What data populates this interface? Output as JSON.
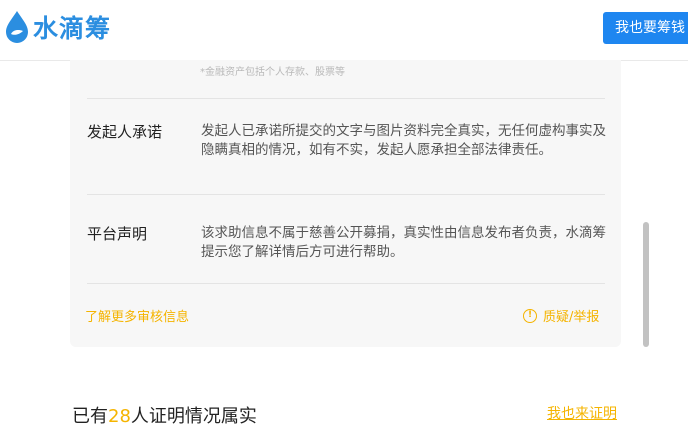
{
  "header": {
    "logo_text": "水滴筹",
    "cta_label": "我也要筹钱"
  },
  "card": {
    "note": "*金融资产包括个人存款、股票等",
    "rows": [
      {
        "label": "发起人承诺",
        "text": "发起人已承诺所提交的文字与图片资料完全真实，无任何虚构事实及隐瞒真相的情况，如有不实，发起人愿承担全部法律责任。"
      },
      {
        "label": "平台声明",
        "text": "该求助信息不属于慈善公开募捐，真实性由信息发布者负责，水滴筹提示您了解详情后方可进行帮助。"
      }
    ],
    "more_link": "了解更多审核信息",
    "report_label": "质疑/举报"
  },
  "verification": {
    "prefix": "已有",
    "count": "28",
    "suffix": "人证明情况属实",
    "link": "我也来证明"
  },
  "colors": {
    "brand": "#2b8ee0",
    "cta": "#1e86f0",
    "accent": "#f5b400"
  }
}
